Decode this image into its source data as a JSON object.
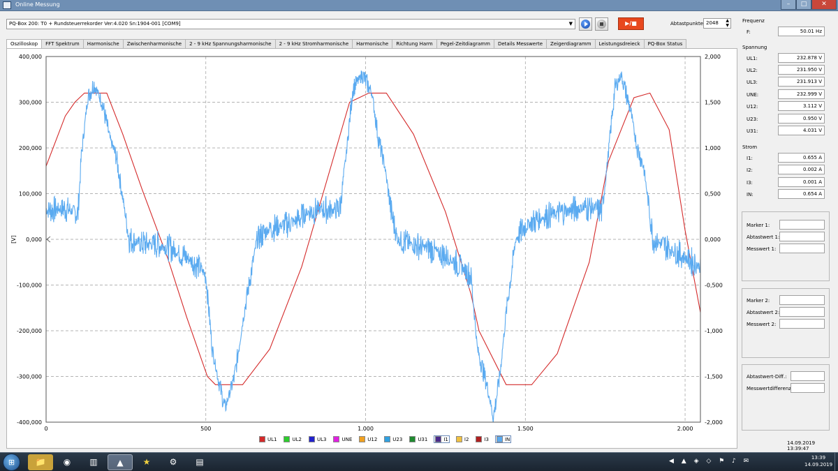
{
  "window": {
    "title": "Online Messung",
    "min_label": "–",
    "max_label": "□",
    "close_label": "✕"
  },
  "device": {
    "selected": "PQ-Box 200: T0 + Rundsteuerrekorder Ver:4.020 Sn:1904-001 [COM9]",
    "play_label": "play",
    "stop_label": "stop",
    "record_label": "▶/■"
  },
  "abtastpunkte": {
    "label": "Abtastpunkte:",
    "value": "2048"
  },
  "tabs": [
    "Oszilloskop",
    "FFT Spektrum",
    "Harmonische",
    "Zwischenharmonische",
    "2 - 9 kHz Spannungsharmonische",
    "2 - 9 kHz Stromharmonische",
    "Harmonische",
    "Richtung Harm",
    "Pegel-Zeitdiagramm",
    "Details Messwerte",
    "Zeigerdiagramm",
    "Leistungsdreieck",
    "PQ-Box Status"
  ],
  "active_tab": "Oszilloskop",
  "sidebar": {
    "frequenz": {
      "heading": "Frequenz",
      "items": [
        {
          "label": "F:",
          "value": "50.01 Hz"
        }
      ]
    },
    "spannung": {
      "heading": "Spannung",
      "items": [
        {
          "label": "UL1:",
          "value": "232.878 V"
        },
        {
          "label": "UL2:",
          "value": "231.950 V"
        },
        {
          "label": "UL3:",
          "value": "231.913 V"
        },
        {
          "label": "UNE:",
          "value": "232.999 V"
        },
        {
          "label": "U12:",
          "value": "3.112 V"
        },
        {
          "label": "U23:",
          "value": "0.950 V"
        },
        {
          "label": "U31:",
          "value": "4.031 V"
        }
      ]
    },
    "strom": {
      "heading": "Strom",
      "items": [
        {
          "label": "I1:",
          "value": "0.655 A"
        },
        {
          "label": "I2:",
          "value": "0.002 A"
        },
        {
          "label": "I3:",
          "value": "0.001 A"
        },
        {
          "label": "IN:",
          "value": "0.654 A"
        }
      ]
    },
    "marker1": {
      "marker": "Marker 1:",
      "abtast": "Abtastwert 1:",
      "mess": "Messwert 1:"
    },
    "marker2": {
      "marker": "Marker 2:",
      "abtast": "Abtastwert 2:",
      "mess": "Messwert 2:"
    },
    "diff": {
      "abtast": "Abtastwert-Diff.:",
      "mess": "Messwertdifferenz:"
    },
    "datetime": "14.09.2019 13:39:47"
  },
  "legend": [
    {
      "name": "UL1",
      "color": "#d42a2a"
    },
    {
      "name": "UL2",
      "color": "#2ecc2e"
    },
    {
      "name": "UL3",
      "color": "#2222cc"
    },
    {
      "name": "UNE",
      "color": "#e020e0"
    },
    {
      "name": "U12",
      "color": "#f0a020"
    },
    {
      "name": "U23",
      "color": "#30a0e0"
    },
    {
      "name": "U31",
      "color": "#208a30"
    },
    {
      "name": "I1",
      "color": "#4a2a8a"
    },
    {
      "name": "I2",
      "color": "#f0c040"
    },
    {
      "name": "I3",
      "color": "#b02020"
    },
    {
      "name": "IN",
      "color": "#5aaaf0"
    }
  ],
  "legend_selected": [
    "I1",
    "IN"
  ],
  "chart_data": {
    "type": "line",
    "ylabel": "[V]",
    "x_ticks": [
      "0",
      "500",
      "1.000",
      "1.500",
      "2.000"
    ],
    "x_tick_values": [
      0,
      500,
      1000,
      1500,
      2000
    ],
    "xlim": [
      0,
      2048
    ],
    "y_left_ticks": [
      "400,000",
      "300,000",
      "200,000",
      "100,000",
      "0,000",
      "-100,000",
      "-200,000",
      "-300,000",
      "-400,000"
    ],
    "y_left_values": [
      400000,
      300000,
      200000,
      100000,
      0,
      -100000,
      -200000,
      -300000,
      -400000
    ],
    "ylim_left": [
      -400000,
      400000
    ],
    "y_right_ticks": [
      "2,000",
      "1,500",
      "1,000",
      "0,500",
      "0,000",
      "-0,500",
      "-1,000",
      "-1,500",
      "-2,000"
    ],
    "y_right_values": [
      2,
      1.5,
      1,
      0.5,
      0,
      -0.5,
      -1,
      -1.5,
      -2
    ],
    "ylim_right": [
      -2,
      2
    ],
    "grid": true,
    "series": [
      {
        "name": "UL1",
        "axis": "left",
        "color": "#d42a2a",
        "x": [
          0,
          60,
          90,
          120,
          190,
          240,
          300,
          380,
          440,
          505,
          530,
          615,
          700,
          800,
          900,
          950,
          1010,
          1065,
          1150,
          1250,
          1330,
          1355,
          1440,
          1520,
          1600,
          1700,
          1760,
          1840,
          1890,
          1950,
          2000,
          2048
        ],
        "y": [
          160000,
          270000,
          300000,
          320000,
          320000,
          230000,
          110000,
          -40000,
          -170000,
          -300000,
          -318000,
          -318000,
          -240000,
          -60000,
          180000,
          300000,
          320000,
          320000,
          230000,
          60000,
          -120000,
          -200000,
          -318000,
          -318000,
          -250000,
          -50000,
          170000,
          310000,
          320000,
          240000,
          20000,
          -160000
        ]
      },
      {
        "name": "IN",
        "axis": "right",
        "color": "#5aaaf0",
        "x": [
          0,
          60,
          100,
          110,
          130,
          150,
          175,
          200,
          220,
          260,
          300,
          340,
          390,
          440,
          480,
          500,
          520,
          540,
          560,
          590,
          620,
          660,
          700,
          740,
          780,
          820,
          860,
          900,
          920,
          940,
          960,
          990,
          1020,
          1040,
          1060,
          1080,
          1100,
          1140,
          1200,
          1260,
          1300,
          1330,
          1350,
          1380,
          1400,
          1420,
          1440,
          1470,
          1500,
          1560,
          1620,
          1680,
          1720,
          1740,
          1760,
          1780,
          1800,
          1830,
          1850,
          1870,
          1900,
          1950,
          2000,
          2048
        ],
        "y": [
          0.32,
          0.34,
          0.28,
          0.9,
          1.55,
          1.7,
          1.5,
          1.1,
          0.9,
          0.0,
          -0.05,
          -0.05,
          -0.1,
          -0.2,
          -0.3,
          -0.4,
          -1.2,
          -1.55,
          -1.85,
          -1.5,
          -0.8,
          0.0,
          0.12,
          0.15,
          0.2,
          0.3,
          0.33,
          0.32,
          0.34,
          0.95,
          1.65,
          1.8,
          1.6,
          1.1,
          0.8,
          0.3,
          0.0,
          -0.05,
          -0.1,
          -0.2,
          -0.3,
          -0.4,
          -1.2,
          -1.6,
          -1.95,
          -1.5,
          -0.8,
          0.0,
          0.15,
          0.25,
          0.3,
          0.35,
          0.34,
          0.3,
          0.95,
          1.65,
          1.8,
          1.4,
          1.0,
          0.8,
          0.0,
          -0.1,
          -0.2,
          -0.3
        ]
      }
    ]
  },
  "taskbar": {
    "start_label": "⊞",
    "apps": [
      "📁",
      "◉",
      "▥",
      "▲",
      "★",
      "⚙",
      "▤"
    ],
    "tray": "◀ ▲ ◈ ◇ ⚑ ♪ ✉",
    "time": "13:39",
    "date": "14.09.2019"
  }
}
